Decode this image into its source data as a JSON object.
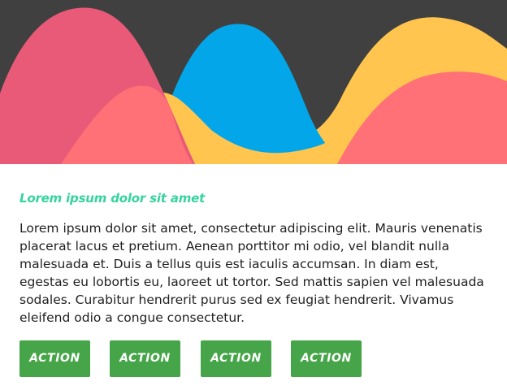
{
  "colors": {
    "background_dark": "#404040",
    "wave_pink": "#e85a78",
    "wave_blue": "#03a7e9",
    "wave_yellow": "#ffc54f",
    "wave_coral": "#ff7176",
    "title_accent": "#36d39f",
    "button_green": "#46a548",
    "button_text": "#ffffff"
  },
  "hero": {
    "icon": "wave-illustration"
  },
  "card": {
    "title": "Lorem ipsum dolor sit amet",
    "body": "Lorem ipsum dolor sit amet, consectetur adipiscing elit. Mauris venenatis placerat lacus et pretium. Aenean porttitor mi odio, vel blandit nulla malesuada et. Duis a tellus quis est iaculis accumsan. In diam est, egestas eu lobortis eu, laoreet ut tortor. Sed mattis sapien vel malesuada sodales. Curabitur hendrerit purus sed ex feugiat hendrerit. Vivamus eleifend odio a congue consectetur."
  },
  "actions": [
    {
      "label": "ACTION"
    },
    {
      "label": "ACTION"
    },
    {
      "label": "ACTION"
    },
    {
      "label": "ACTION"
    }
  ]
}
